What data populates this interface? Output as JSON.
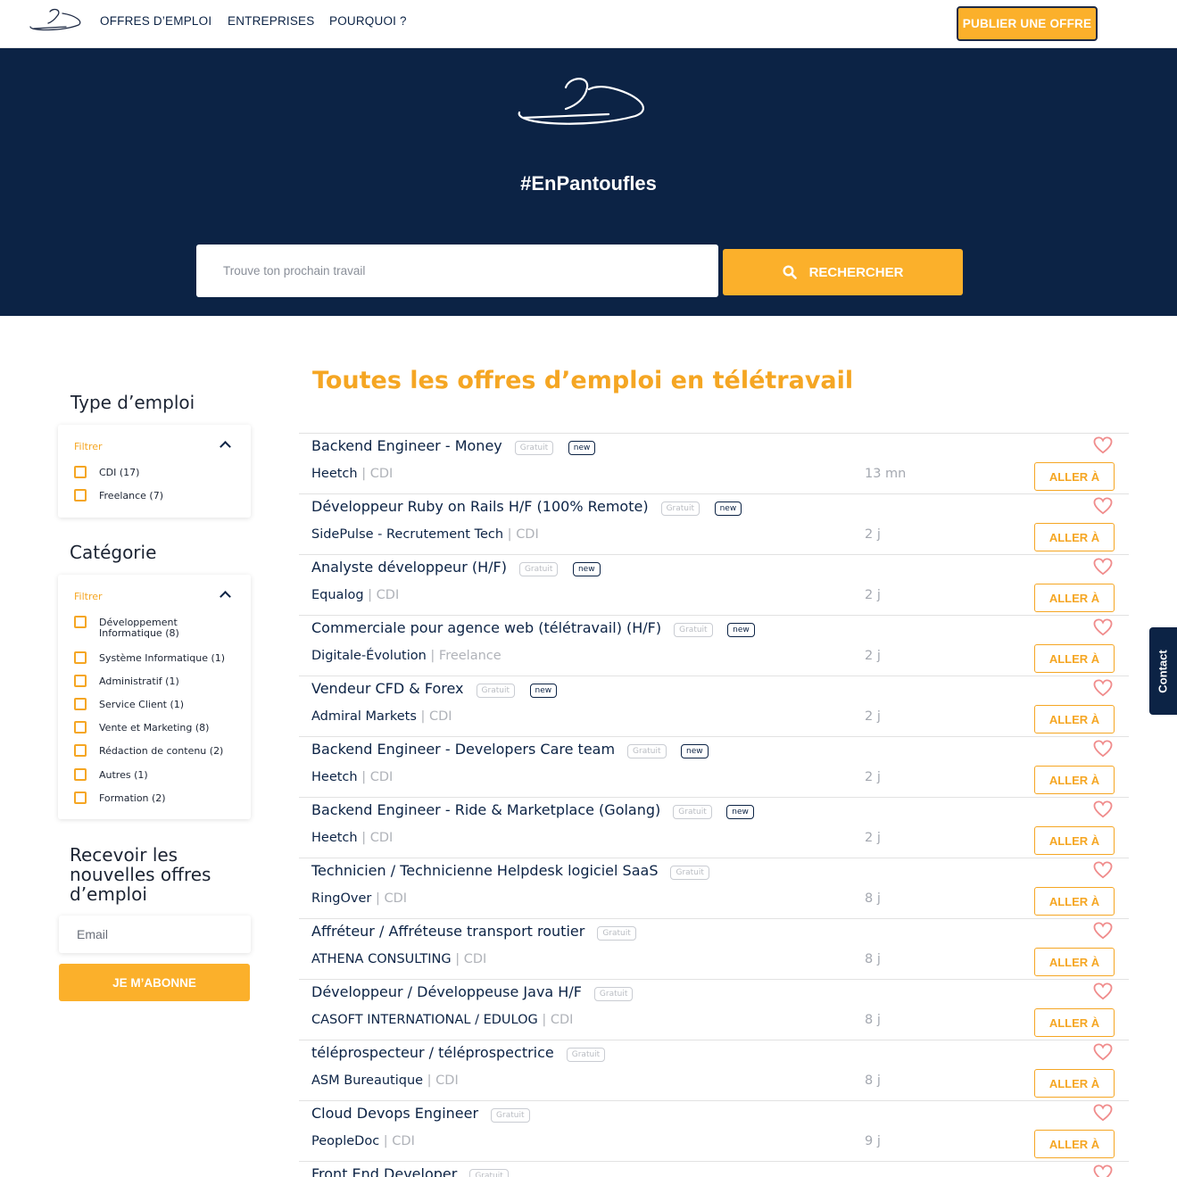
{
  "nav": {
    "links": [
      "OFFRES D’EMPLOI",
      "ENTREPRISES",
      "POURQUOI ?"
    ],
    "publish_label": "PUBLIER UNE OFFRE"
  },
  "hero": {
    "tagline": "#EnPantoufles",
    "search_placeholder": "Trouve ton prochain travail",
    "search_button": "RECHERCHER"
  },
  "sidebar": {
    "type": {
      "title": "Type d’emploi",
      "filter_label": "Filtrer",
      "options": [
        "CDI (17)",
        "Freelance (7)"
      ]
    },
    "category": {
      "title": "Catégorie",
      "filter_label": "Filtrer",
      "options": [
        "Développement Informatique (8)",
        "Système Informatique (1)",
        "Administratif (1)",
        "Service Client (1)",
        "Vente et Marketing (8)",
        "Rédaction de contenu (2)",
        "Autres (1)",
        "Formation (2)"
      ]
    },
    "newsletter": {
      "title": "Recevoir les nouvelles offres d’emploi",
      "email_placeholder": "Email",
      "subscribe_label": "JE M’ABONNE"
    }
  },
  "main": {
    "title": "Toutes les offres d’emploi en télétravail",
    "free_badge": "Gratuit",
    "new_badge": "new",
    "go_label": "ALLER À",
    "jobs": [
      {
        "title": "Backend Engineer - Money",
        "company": "Heetch",
        "type": "CDI",
        "age": "13 mn",
        "is_new": true
      },
      {
        "title": "Développeur Ruby on Rails H/F (100% Remote)",
        "company": "SidePulse - Recrutement Tech",
        "type": "CDI",
        "age": "2 j",
        "is_new": true
      },
      {
        "title": "Analyste développeur (H/F)",
        "company": "Equalog",
        "type": "CDI",
        "age": "2 j",
        "is_new": true
      },
      {
        "title": "Commerciale pour agence web (télétravail) (H/F)",
        "company": "Digitale-Évolution",
        "type": "Freelance",
        "age": "2 j",
        "is_new": true
      },
      {
        "title": "Vendeur CFD & Forex",
        "company": "Admiral Markets",
        "type": "CDI",
        "age": "2 j",
        "is_new": true
      },
      {
        "title": "Backend Engineer - Developers Care team",
        "company": "Heetch",
        "type": "CDI",
        "age": "2 j",
        "is_new": true
      },
      {
        "title": "Backend Engineer - Ride & Marketplace (Golang)",
        "company": "Heetch",
        "type": "CDI",
        "age": "2 j",
        "is_new": true
      },
      {
        "title": "Technicien / Technicienne Helpdesk logiciel SaaS",
        "company": "RingOver",
        "type": "CDI",
        "age": "8 j",
        "is_new": false
      },
      {
        "title": "Affréteur / Affréteuse transport routier",
        "company": "ATHENA CONSULTING",
        "type": "CDI",
        "age": "8 j",
        "is_new": false
      },
      {
        "title": "Développeur / Développeuse Java H/F",
        "company": "CASOFT INTERNATIONAL / EDULOG",
        "type": "CDI",
        "age": "8 j",
        "is_new": false
      },
      {
        "title": "téléprospecteur / téléprospectrice",
        "company": "ASM Bureautique",
        "type": "CDI",
        "age": "8 j",
        "is_new": false
      },
      {
        "title": "Cloud Devops Engineer",
        "company": "PeopleDoc",
        "type": "CDI",
        "age": "9 j",
        "is_new": false
      },
      {
        "title": "Front End Developer",
        "company": "",
        "type": "",
        "age": "",
        "is_new": false
      }
    ]
  },
  "contact": {
    "label": "Contact"
  },
  "colors": {
    "navy": "#0c2345",
    "accent": "#fbb02b",
    "heart": "#f08c8c"
  }
}
